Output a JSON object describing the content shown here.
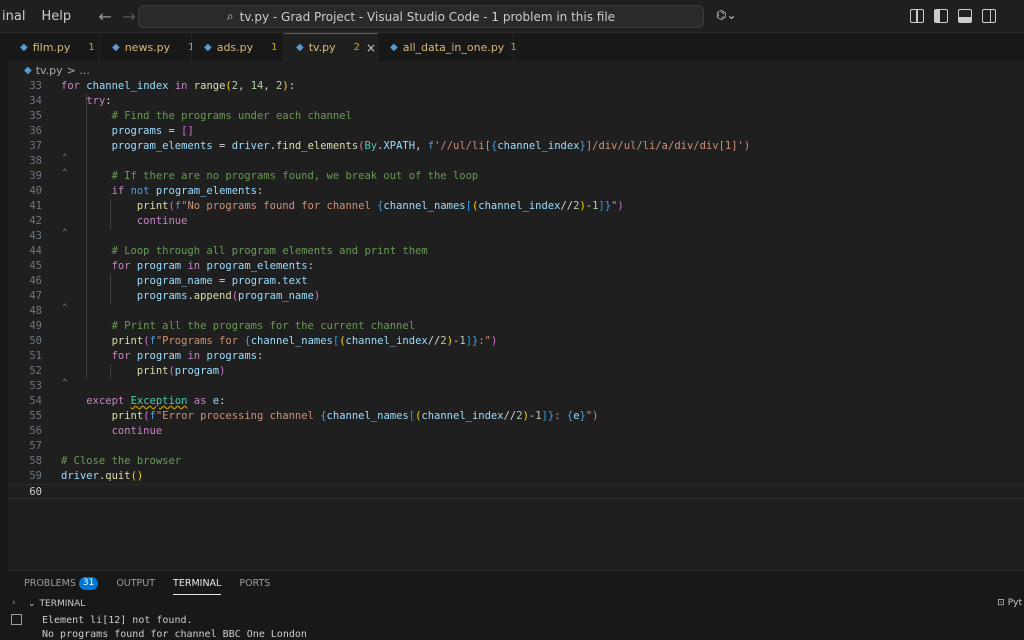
{
  "titlebar": {
    "menu": [
      "inal",
      "Help"
    ],
    "search_text": "tv.py - Grad Project - Visual Studio Code - 1 problem in this file",
    "copilot_glyph": "⌬⌄"
  },
  "tabs": [
    {
      "name": "film.py",
      "count": "1"
    },
    {
      "name": "news.py",
      "count": "1"
    },
    {
      "name": "ads.py",
      "count": "1"
    },
    {
      "name": "tv.py",
      "count": "2",
      "close": "×"
    },
    {
      "name": "all_data_in_one.py",
      "count": "1"
    }
  ],
  "breadcrumb": {
    "file": "tv.py",
    "rest": "> ..."
  },
  "editor": {
    "line_numbers": [
      "33",
      "34",
      "35",
      "36",
      "37",
      "38",
      "39",
      "40",
      "41",
      "42",
      "43",
      "44",
      "45",
      "46",
      "47",
      "48",
      "49",
      "50",
      "51",
      "52",
      "53",
      "54",
      "55",
      "56",
      "57",
      "58",
      "59",
      "60"
    ]
  },
  "panel": {
    "tabs": [
      "PROBLEMS",
      "OUTPUT",
      "TERMINAL",
      "PORTS"
    ],
    "problems_count": "31",
    "terminal_header": "TERMINAL",
    "terminal_right": "Pyt",
    "terminal_lines": [
      "Element li[12] not found.",
      "No programs found for channel BBC One London"
    ]
  },
  "colors": {
    "accent": "#0078d4",
    "editor_bg": "#1f1f1f",
    "tab_text": "#d7ba7d"
  }
}
